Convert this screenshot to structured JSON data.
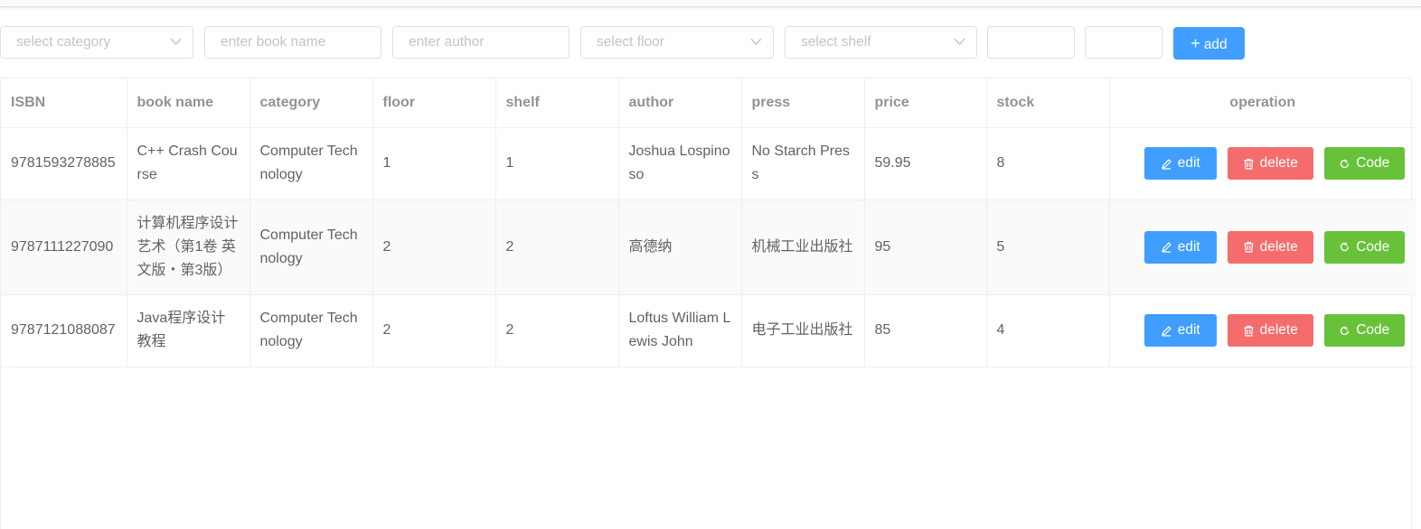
{
  "filters": {
    "category_placeholder": "select category",
    "book_name_placeholder": "enter book name",
    "author_placeholder": "enter author",
    "floor_placeholder": "select floor",
    "shelf_placeholder": "select shelf",
    "price_min_value": "",
    "price_max_value": "",
    "add_label": "add",
    "add_icon": "plus-icon"
  },
  "colors": {
    "primary": "#409eff",
    "danger": "#f56c6c",
    "success": "#67c23a",
    "header_text": "#909399",
    "body_text": "#606266",
    "border": "#ebeef5"
  },
  "table": {
    "columns": [
      "ISBN",
      "book name",
      "category",
      "floor",
      "shelf",
      "author",
      "press",
      "price",
      "stock",
      "operation"
    ],
    "rows": [
      {
        "isbn": "9781593278885",
        "book_name": "C++ Crash Course",
        "category": "Computer Technology",
        "floor": "1",
        "shelf": "1",
        "author": "Joshua Lospinoso",
        "press": "No Starch Press",
        "price": "59.95",
        "stock": "8"
      },
      {
        "isbn": "9787111227090",
        "book_name": "计算机程序设计艺术（第1卷 英文版・第3版）",
        "category": "Computer Technology",
        "floor": "2",
        "shelf": "2",
        "author": "高德纳",
        "press": "机械工业出版社",
        "price": "95",
        "stock": "5"
      },
      {
        "isbn": "9787121088087",
        "book_name": "Java程序设计教程",
        "category": "Computer Technology",
        "floor": "2",
        "shelf": "2",
        "author": "Loftus William Lewis John",
        "press": "电子工业出版社",
        "price": "85",
        "stock": "4"
      }
    ],
    "actions": {
      "edit_label": "edit",
      "delete_label": "delete",
      "code_label": "Code",
      "edit_icon": "pencil-icon",
      "delete_icon": "trash-icon",
      "code_icon": "refresh-icon"
    }
  }
}
